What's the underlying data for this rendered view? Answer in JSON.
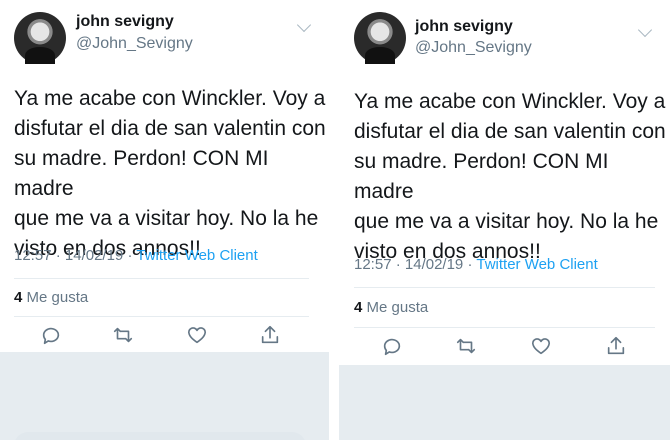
{
  "tweet": {
    "user_name": "john sevigny",
    "handle": "@John_Sevigny",
    "text_lines": [
      "Ya me acabe con Winckler. Voy a",
      "disfutar el dia de san valentin con",
      "su madre. Perdon! CON MI madre",
      "que me va a visitar hoy. No la he",
      "visto en dos annos!!"
    ],
    "time": "12:57",
    "date": "14/02/19",
    "separator": "·",
    "client": "Twitter Web Client",
    "likes_count": "4",
    "likes_label": "Me gusta"
  },
  "icons": {
    "avatar": "profile-photo",
    "menu": "chevron-down-icon",
    "reply": "reply-icon",
    "retweet": "retweet-icon",
    "like": "heart-icon",
    "share": "share-icon"
  },
  "colors": {
    "text": "#14171a",
    "secondary": "#657786",
    "link": "#1da1f2",
    "divider": "#e6ecf0"
  }
}
